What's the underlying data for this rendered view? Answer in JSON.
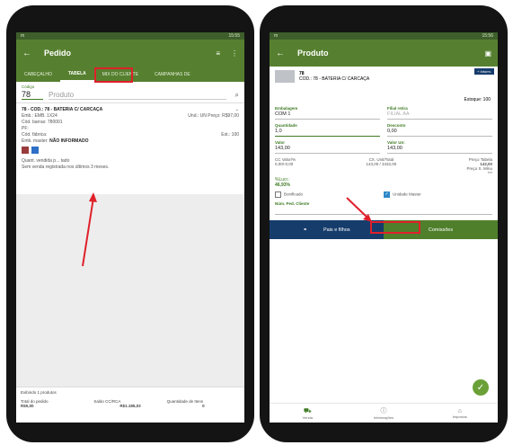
{
  "left": {
    "status_time": "15:55",
    "status_icon": "m",
    "title": "Pedido",
    "tabs": [
      "CABEÇALHO",
      "TABELA",
      "MIX DO CLIENTE",
      "CAMPANHAS DE"
    ],
    "code_label": "Código",
    "code_value": "78",
    "product_placeholder": "Produto",
    "product": {
      "heading": "78 - COD.: 78 - BATERIA C/ CARCAÇA",
      "emb": "Emb.: EMB. 1X24",
      "und": "Und.: UN",
      "preco": "Preço: R$97,00",
      "cod_barras": "Cód. barras: 780001",
      "pf": "PF:",
      "cod_fabrica": "Cód. fábrica:",
      "est": "Est.: 100",
      "emb_master_label": "Emb. master:",
      "emb_master_value": "NÃO INFORMADO",
      "quant_vendida": "Quant. vendida p... tado",
      "sem_venda": "Sem venda registrada nos últimos 3 meses."
    },
    "footer": {
      "exibindo": "Exibindo 1 produtos",
      "cols": [
        {
          "label": "Total do pedido",
          "value": "R$0,00"
        },
        {
          "label": "Saldo CC/RCA",
          "value": "R$1.185,03"
        },
        {
          "label": "Quantidade de Itens",
          "value": "0"
        }
      ]
    }
  },
  "right": {
    "status_time": "15:56",
    "status_icon": "m",
    "title": "Produto",
    "mais_info": "+ Inform.",
    "product_code": "78",
    "product_name": "COD.: 78 - BATERIA C/ CARCAÇA",
    "estoque": "Estoque: 100",
    "embalagem_label": "Embalagem",
    "embalagem_value": "COM 1",
    "filial_label": "Filial retira",
    "filial_value": "FILIAL AA",
    "quantidade_label": "Quantidade",
    "quantidade_value": "1,0",
    "desconto_label": "Desconto",
    "desconto_value": "0,00",
    "valor_label": "Valor",
    "valor_value": "143,00",
    "valor_un_label": "Valor Un:",
    "valor_un_value": "143,00",
    "cc_label": "CC Valor/%",
    "cc_value": "0,00/-0,00",
    "cx_label": "CX. Unit/Total",
    "cx_value": "143,00 / 3432,00",
    "preco_tabela_label": "Preço Tabela",
    "preco_tabela_value": "143,00",
    "preco_min_label": "Preço S. Mínu",
    "preco_min_value": "***",
    "lucro_label": "%Lucr.:",
    "lucro_value": "46,93%",
    "bonificado_label": "Bonificado",
    "unidade_master_label": "Unidade Master",
    "num_ped_label": "Núm. Ped. Cliente",
    "btn_pais": "Pais e filhos",
    "btn_comissoes": "Comissões",
    "nav": [
      "Venda",
      "Informações",
      "Impostos"
    ],
    "colors": {
      "green": "#56802f",
      "dark_blue": "#163c6c",
      "btn_green": "#4f7f2b",
      "highlight": "#e0202a"
    }
  }
}
